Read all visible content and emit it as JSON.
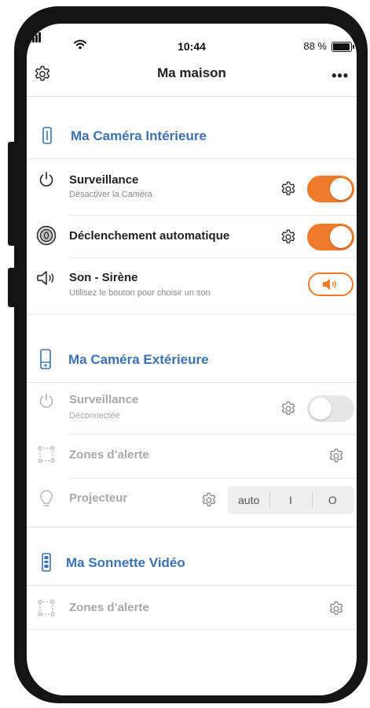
{
  "status_bar": {
    "time": "10:44",
    "battery": "88 %",
    "battery_level": 0.88
  },
  "header": {
    "title": "Ma maison",
    "settings_icon": "gear-icon",
    "more_icon": "more-icon",
    "more_label": "•••"
  },
  "indoor_camera": {
    "title": "Ma Caméra Intérieure",
    "surveillance": {
      "label": "Surveillance",
      "sub": "Désactiver la Caméra",
      "enabled": true
    },
    "auto_trigger": {
      "label": "Déclenchement automatique",
      "enabled": true
    },
    "siren": {
      "label": "Son - Sirène",
      "sub": "Utilisez le bouton pour choisir un son"
    }
  },
  "outdoor_camera": {
    "title": "Ma Caméra Extérieure",
    "surveillance": {
      "label": "Surveillance",
      "sub": "Déconnectée",
      "enabled": false
    },
    "alert_zones": {
      "label": "Zones d’alerte"
    },
    "projector": {
      "label": "Projecteur",
      "options": [
        "auto",
        "I",
        "O"
      ]
    }
  },
  "video_doorbell": {
    "title": "Ma Sonnette Vidéo",
    "alert_zones": {
      "label": "Zones d’alerte"
    }
  },
  "colors": {
    "accent": "#ee7a2b",
    "section_title": "#3b72b4",
    "disabled": "#a8a8a8"
  }
}
